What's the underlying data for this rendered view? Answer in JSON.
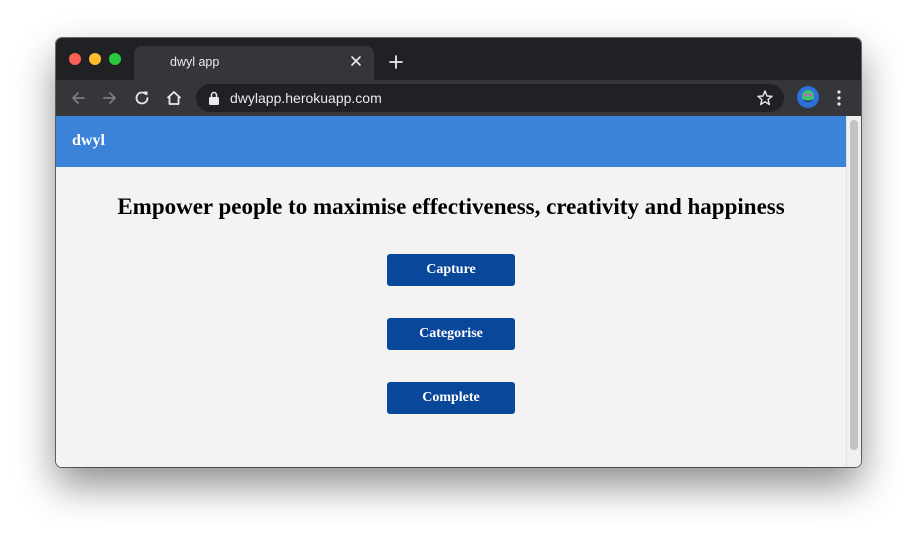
{
  "browser": {
    "tab_title": "dwyl app",
    "url": "dwylapp.herokuapp.com",
    "icons": [
      "back-icon",
      "forward-icon",
      "reload-icon",
      "home-icon",
      "lock-icon",
      "bookmark-star-icon",
      "close-icon",
      "new-tab-icon",
      "menu-icon"
    ]
  },
  "page": {
    "brand": "dwyl",
    "headline": "Empower people to maximise effectiveness, creativity and happiness",
    "buttons": [
      "Capture",
      "Categorise",
      "Complete"
    ]
  },
  "colors": {
    "navbar": "#3b82d9",
    "button": "#08479a",
    "page_background": "#f3f3f3"
  }
}
